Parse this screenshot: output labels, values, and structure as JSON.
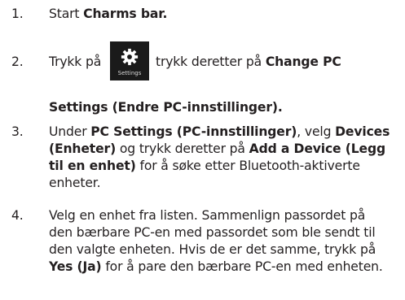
{
  "steps": [
    {
      "number": "1.",
      "prefix": "Start ",
      "bold": "Charms bar."
    },
    {
      "number": "2.",
      "before": "Trykk på",
      "icon": "settings-gear-icon",
      "icon_caption": "Settings",
      "after": "trykk deretter på ",
      "bold_a": "Change PC",
      "bold_b": "Settings (Endre PC-innstillinger)."
    },
    {
      "number": "3.",
      "t1": "Under ",
      "b1": "PC Settings (PC-innstillinger)",
      "t2": ", velg ",
      "b2": "Devices",
      "b3": "(Enheter)",
      "t3": " og trykk deretter på ",
      "b4": "Add a Device (Legg",
      "b5": "til en enhet)",
      "t4": " for å søke etter Bluetooth-aktiverte",
      "t5": "enheter."
    },
    {
      "number": "4.",
      "l1": "Velg en enhet fra listen. Sammenlign passordet på",
      "l2": "den bærbare PC-en med passordet som ble sendt til",
      "l3": "den valgte enheten. Hvis de er det samme, trykk på",
      "b1": "Yes (Ja)",
      "l4": " for å pare den bærbare PC-en med enheten."
    }
  ]
}
